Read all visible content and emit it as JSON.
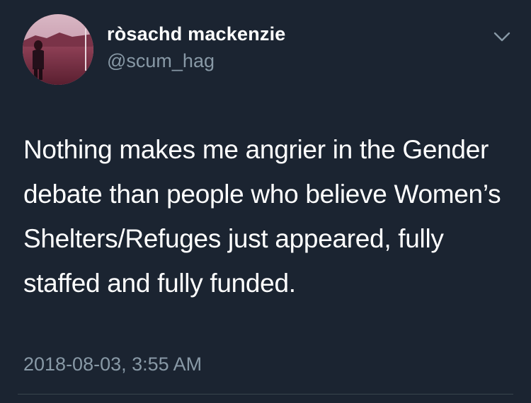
{
  "user": {
    "display_name": "ròsachd mackenzie",
    "handle": "@scum_hag"
  },
  "tweet": {
    "text": "Nothing makes me angrier in the Gender debate than people who believe Women’s Shelters/Refuges just appeared, fully staffed and fully funded.",
    "timestamp": "2018-08-03, 3:55 AM"
  },
  "icons": {
    "menu": "chevron-down-icon"
  },
  "colors": {
    "background": "#1b2431",
    "text_primary": "#ffffff",
    "text_secondary": "#8899a6",
    "divider": "#38444d"
  }
}
